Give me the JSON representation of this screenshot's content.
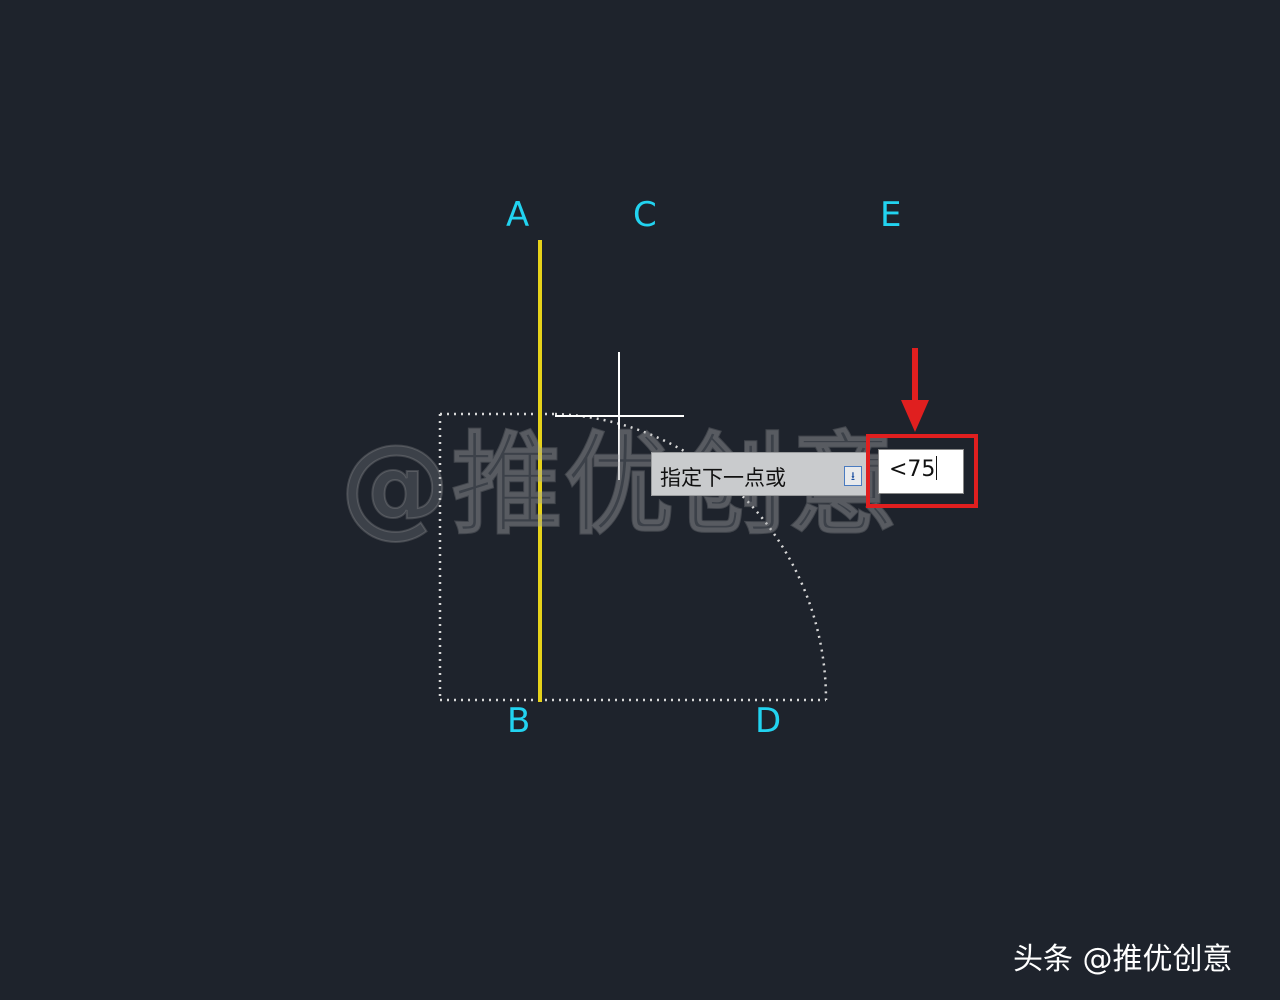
{
  "labels": {
    "a": "A",
    "b": "B",
    "c": "C",
    "d": "D",
    "e": "E"
  },
  "watermark": "@推优创意",
  "prompt": {
    "text": "指定下一点或",
    "toggle_icon": "down-arrow-icon"
  },
  "input": {
    "value": "<75"
  },
  "footer": "头条 @推优创意",
  "colors": {
    "background": "#1e232c",
    "label": "#22d3f0",
    "yellow_line": "#e6d21a",
    "highlight": "#e01f1f",
    "arrow": "#e01f1f"
  }
}
